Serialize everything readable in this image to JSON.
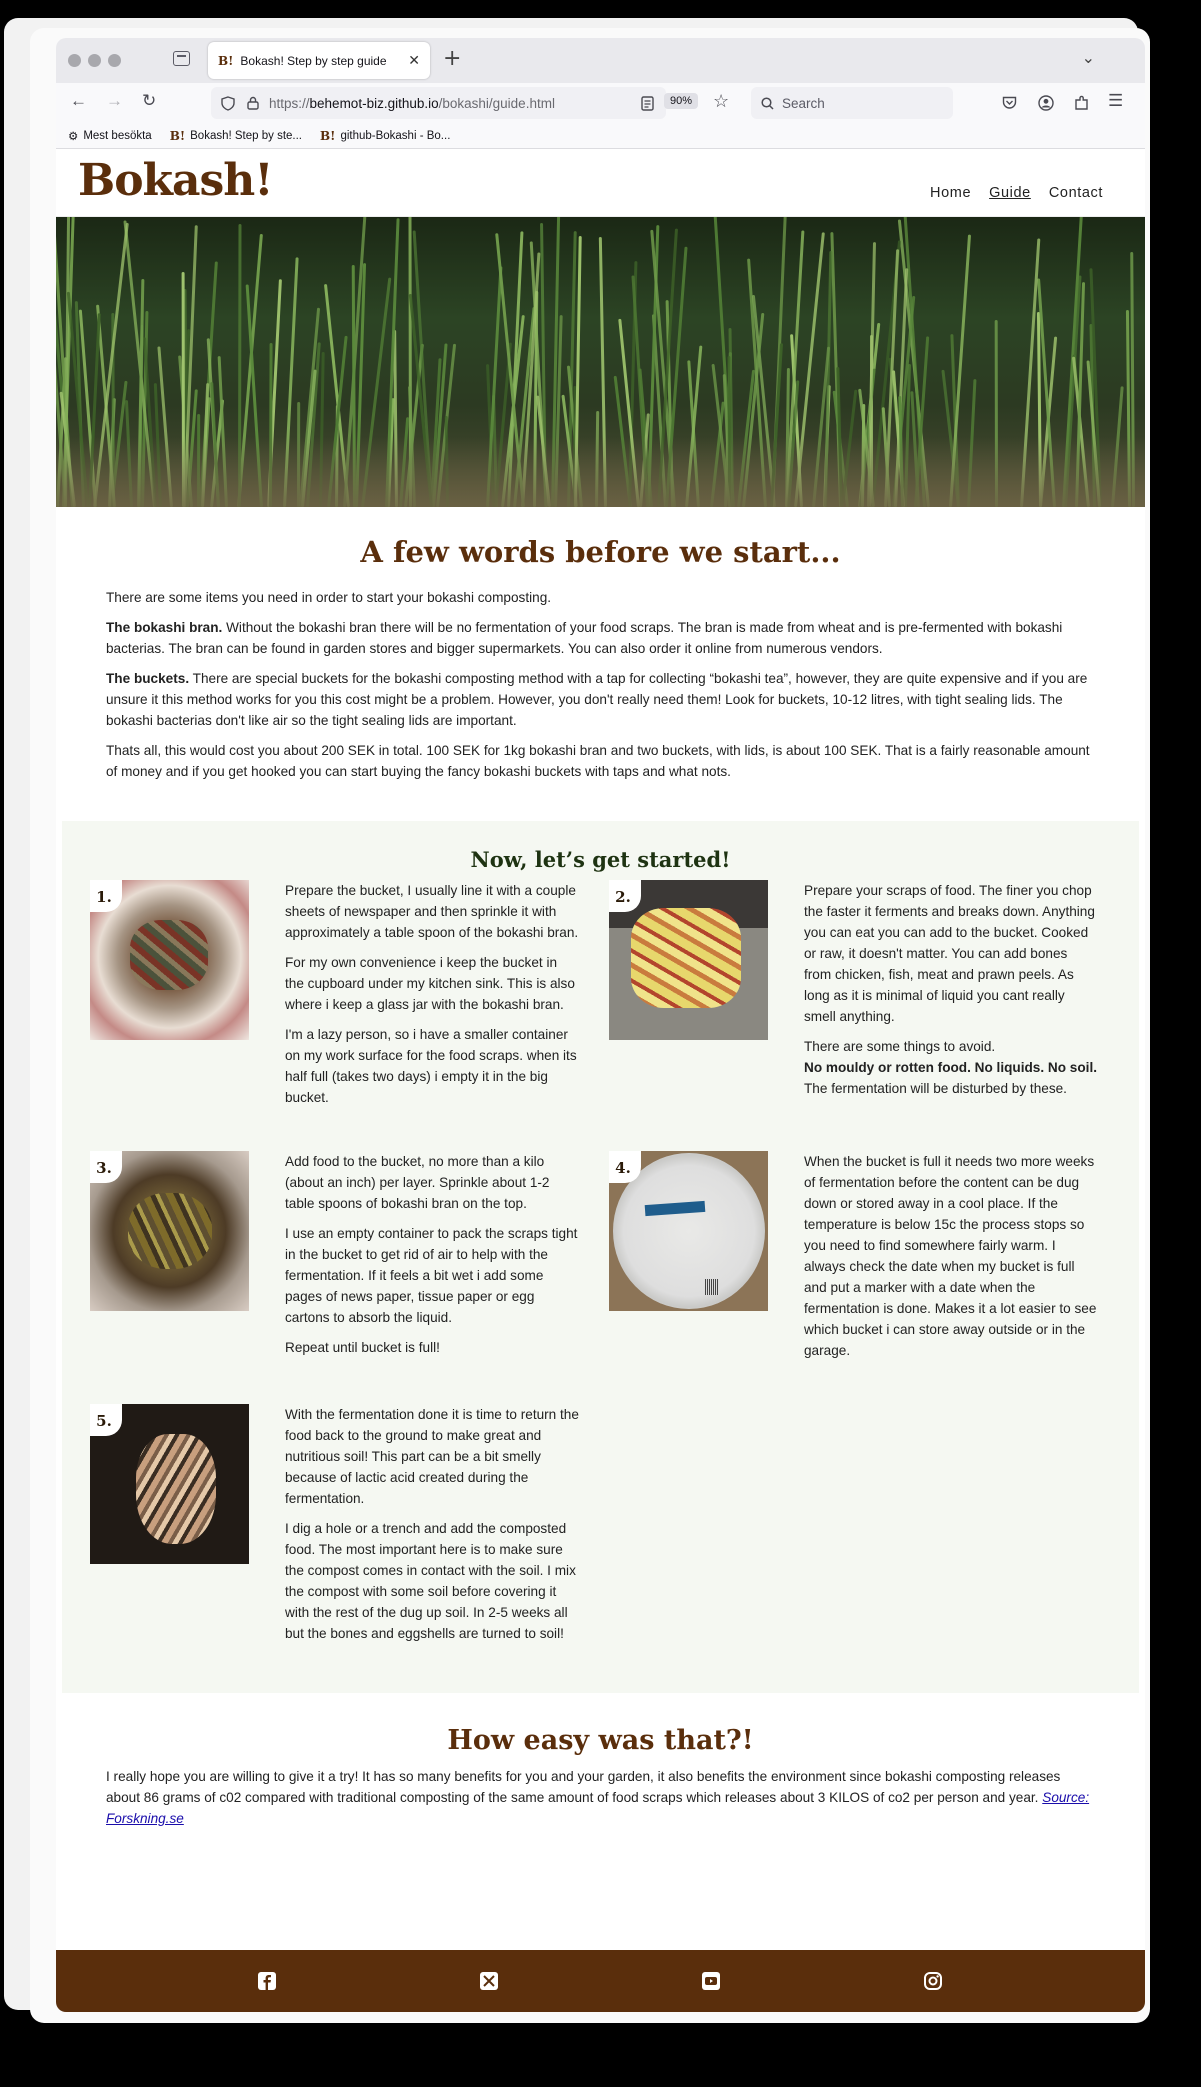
{
  "browser": {
    "tab_title": "Bokash! Step by step guide",
    "url_prefix": "https://",
    "url_host": "behemot-biz.github.io",
    "url_path": "/bokashi/guide.html",
    "zoom": "90%",
    "search_placeholder": "Search",
    "bookmarks": [
      "Mest besökta",
      "Bokash! Step by ste...",
      "github-Bokashi - Bo..."
    ]
  },
  "site": {
    "logo": "Bokash!",
    "nav": [
      "Home",
      "Guide",
      "Contact"
    ]
  },
  "intro": {
    "title": "A few words before we start...",
    "lead": "There are some items you need in order to start your bokashi composting.",
    "bran_label": "The bokashi bran.",
    "bran_text": " Without the bokashi bran there will be no fermentation of your food scraps. The bran is made from wheat and is pre-fermented with bokashi bacterias. The bran can be found in garden stores and bigger supermarkets. You can also order it online from numerous vendors.",
    "buckets_label": "The buckets.",
    "buckets_text": " There are special buckets for the bokashi composting method with a tap for collecting “bokashi tea”, however, they are quite expensive and if you are unsure it this method works for you this cost might be a problem. However, you don't really need them! Look for buckets, 10-12 litres, with tight sealing lids. The bokashi bacterias don't like air so the tight sealing lids are important.",
    "cost": "Thats all, this would cost you about 200 SEK in total. 100 SEK for 1kg bokashi bran and two buckets, with lids, is about 100 SEK. That is a fairly reasonable amount of money and if you get hooked you can start buying the fancy bokashi buckets with taps and what nots."
  },
  "steps": {
    "title": "Now, let’s get started!",
    "s1": {
      "num": "1.",
      "p1": "Prepare the bucket, I usually line it with a couple sheets of newspaper and then sprinkle it with approximately a table spoon of the bokashi bran.",
      "p2": "For my own convenience i keep the bucket in the cupboard under my kitchen sink. This is also where i keep a glass jar with the bokashi bran.",
      "p3": "I'm a lazy person, so i have a smaller container on my work surface for the food scraps. when its half full (takes two days) i empty it in the big bucket."
    },
    "s2": {
      "num": "2.",
      "p1": "Prepare your scraps of food. The finer you chop the faster it ferments and breaks down. Anything you can eat you can add to the bucket. Cooked or raw, it doesn't matter. You can add bones from chicken, fish, meat and prawn peels. As long as it is minimal of liquid you cant really smell anything.",
      "p2a": "There are some things to avoid.",
      "p2b": "No mouldy or rotten food. No liquids. No soil.",
      "p2c": "The fermentation will be disturbed by these."
    },
    "s3": {
      "num": "3.",
      "p1": "Add food to the bucket, no more than a kilo (about an inch) per layer. Sprinkle about 1-2 table spoons of bokashi bran on the top.",
      "p2": "I use an empty container to pack the scraps tight in the bucket to get rid of air to help with the fermentation. If it feels a bit wet i add some pages of news paper, tissue paper or egg cartons to absorb the liquid.",
      "p3": "Repeat until bucket is full!"
    },
    "s4": {
      "num": "4.",
      "p1": "When the bucket is full it needs two more weeks of fermentation before the content can be dug down or stored away in a cool place. If the temperature is below 15c the process stops so you need to find somewhere fairly warm. I always check the date when my bucket is full and put a marker with a date when the fermentation is done. Makes it a lot easier to see which bucket i can store away outside or in the garage."
    },
    "s5": {
      "num": "5.",
      "p1": "With the fermentation done it is time to return the food back to the ground to make great and nutritious soil! This part can be a bit smelly because of lactic acid created during the fermentation.",
      "p2": "I dig a hole or a trench and add the composted food. The most important here is to make sure the compost comes in contact with the soil. I mix the compost with some soil before covering it with the rest of the dug up soil. In 2-5 weeks all but the bones and eggshells are turned to soil!"
    }
  },
  "outro": {
    "title": "How easy was that?!",
    "text": "I really hope you are willing to give it a try! It has so many benefits for you and your garden, it also benefits the environment since bokashi composting releases about 86 grams of c02 compared with traditional composting of the same amount of food scraps which releases about 3 KILOS of co2 per person and year. ",
    "source": "Source: Forskning.se"
  },
  "footer": {
    "icons": [
      "facebook-icon",
      "x-twitter-icon",
      "youtube-icon",
      "instagram-icon"
    ]
  },
  "colors": {
    "brand_brown": "#5a2e0c",
    "steps_bg": "#f5f8f2",
    "steps_heading": "#1e3312"
  }
}
